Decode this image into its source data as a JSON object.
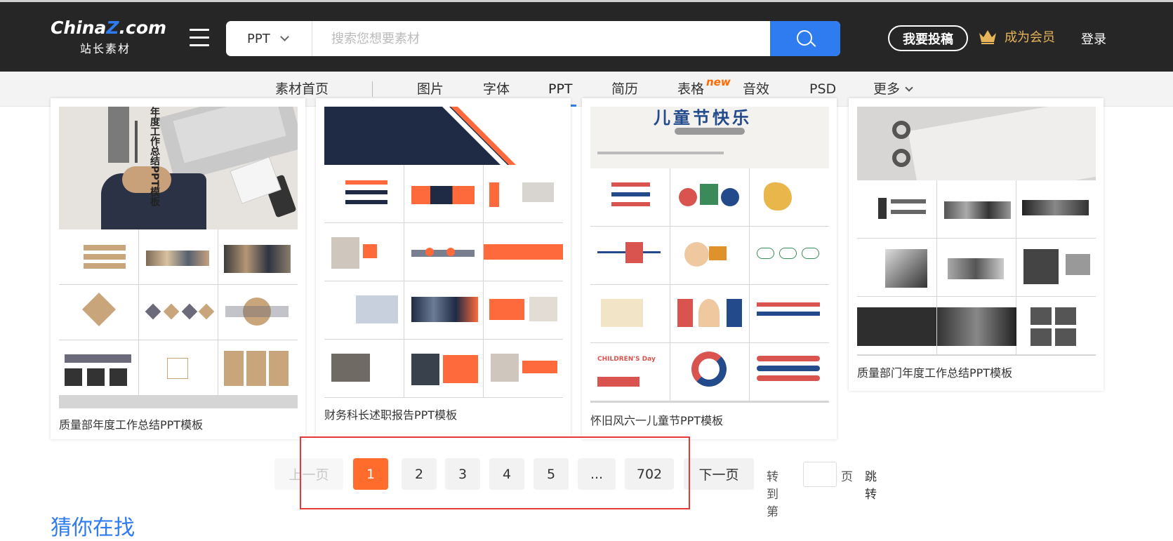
{
  "header": {
    "logo_main_1": "China",
    "logo_main_z": "Z",
    "logo_main_2": ".com",
    "logo_sub": "站长素材",
    "search_category": "PPT",
    "search_placeholder": "搜索您想要素材",
    "contribute_label": "我要投稿",
    "vip_label": "成为会员",
    "login_label": "登录",
    "colors": {
      "bar": "#262626",
      "accent": "#2f7bf0",
      "vip": "#e7b45a"
    }
  },
  "nav": {
    "items": [
      "素材首页",
      "图片",
      "字体",
      "PPT",
      "简历",
      "表格",
      "音效",
      "PSD",
      "更多"
    ],
    "new_badge": "new",
    "active": "PPT"
  },
  "cards": [
    {
      "title": "质量部年度工作总结PPT模板",
      "hero_text": "年度工作总结PPT模板"
    },
    {
      "title": "财务科长述职报告PPT模板"
    },
    {
      "title": "怀旧风六一儿童节PPT模板",
      "hero_text": "儿童节快乐",
      "cell_text": "CHILDREN'S Day"
    },
    {
      "title": "质量部门年度工作总结PPT模板"
    }
  ],
  "pagination": {
    "prev_label": "上一页",
    "pages": [
      "1",
      "2",
      "3",
      "4",
      "5",
      "...",
      "702"
    ],
    "current": "1",
    "next_label": "下一页",
    "goto_prefix": "转到第",
    "goto_suffix": "页",
    "goto_button": "跳转",
    "current_color": "#ff6c2c"
  },
  "section": {
    "title": "猜你在找"
  }
}
